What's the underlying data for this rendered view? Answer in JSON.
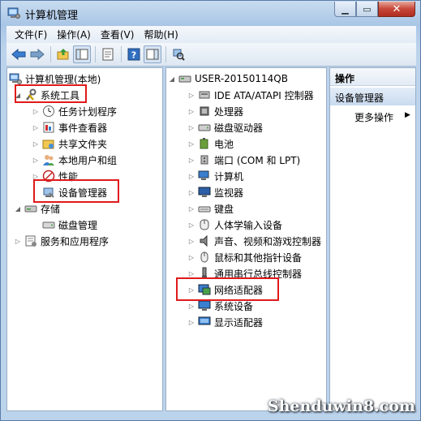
{
  "window": {
    "title": "计算机管理"
  },
  "menu": [
    "文件(F)",
    "操作(A)",
    "查看(V)",
    "帮助(H)"
  ],
  "left_tree": {
    "root": "计算机管理(本地)",
    "system_tools": "系统工具",
    "task_scheduler": "任务计划程序",
    "event_viewer": "事件查看器",
    "shared_folders": "共享文件夹",
    "local_users": "本地用户和组",
    "performance": "性能",
    "device_manager": "设备管理器",
    "storage": "存储",
    "disk_management": "磁盘管理",
    "services_apps": "服务和应用程序"
  },
  "device_tree": {
    "computer_name": "USER-20150114QB",
    "categories": [
      "IDE ATA/ATAPI 控制器",
      "处理器",
      "磁盘驱动器",
      "电池",
      "端口 (COM 和 LPT)",
      "计算机",
      "监视器",
      "键盘",
      "人体学输入设备",
      "声音、视频和游戏控制器",
      "鼠标和其他指针设备",
      "通用串行总线控制器",
      "网络适配器",
      "系统设备",
      "显示适配器"
    ]
  },
  "actions": {
    "header": "操作",
    "section": "设备管理器",
    "more": "更多操作"
  },
  "watermark": "Shenduwin8.com",
  "colors": {
    "highlight": "#e01a1a",
    "chrome": "#bcd3ec"
  }
}
